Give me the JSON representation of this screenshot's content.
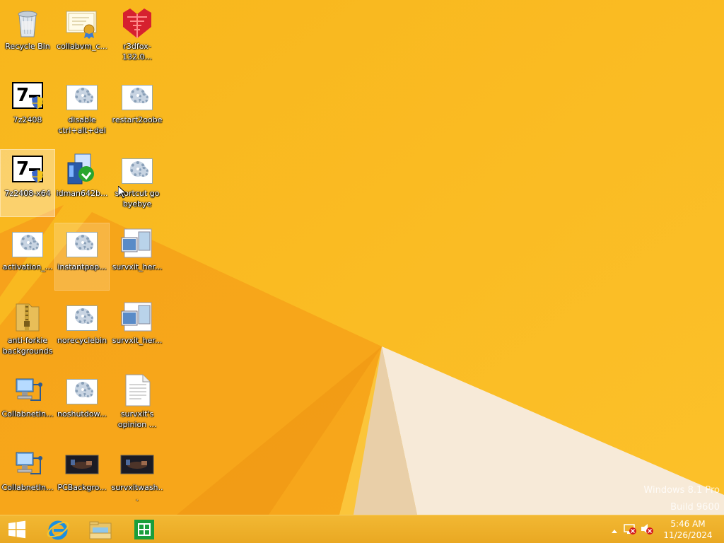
{
  "desktop": {
    "icons": [
      {
        "label": "Recycle Bin",
        "icon": "recycle-bin-icon"
      },
      {
        "label": "collabvm_c...",
        "icon": "certificate-icon"
      },
      {
        "label": "r3dfox-132.0...",
        "icon": "r3dfox-icon"
      },
      {
        "label": "7z2408",
        "icon": "7zip-installer-icon"
      },
      {
        "label": "disable ctrl+alt+del",
        "icon": "settings-file-icon"
      },
      {
        "label": "restart2oobe",
        "icon": "settings-file-icon"
      },
      {
        "label": "7z2408-x64",
        "icon": "7zip-installer-icon"
      },
      {
        "label": "idman642b...",
        "icon": "installer-icon"
      },
      {
        "label": "shortcut go byebye",
        "icon": "settings-file-icon"
      },
      {
        "label": "activation_...",
        "icon": "settings-file-icon"
      },
      {
        "label": "instantpop...",
        "icon": "settings-file-icon"
      },
      {
        "label": "survxit_her...",
        "icon": "image-file-icon"
      },
      {
        "label": "anti-forkie backgrounds",
        "icon": "zip-folder-icon"
      },
      {
        "label": "norecyclebin",
        "icon": "settings-file-icon"
      },
      {
        "label": "survxit_her...",
        "icon": "image-file-icon"
      },
      {
        "label": "CollabnetIn...",
        "icon": "network-computer-icon"
      },
      {
        "label": "noshutdow...",
        "icon": "settings-file-icon"
      },
      {
        "label": "survxit's opinion ...",
        "icon": "text-document-icon"
      },
      {
        "label": "CollabnetIn...",
        "icon": "network-computer-icon"
      },
      {
        "label": "PCBackgro...",
        "icon": "image-thumbnail-icon"
      },
      {
        "label": "survxitwash...",
        "icon": "image-thumbnail-icon"
      }
    ]
  },
  "watermark": {
    "line1": "Windows 8.1 Pro",
    "line2": "Build 9600"
  },
  "taskbar": {
    "start": "start-icon",
    "pinned": [
      "internet-explorer-icon",
      "file-explorer-icon",
      "store-icon"
    ],
    "tray": {
      "time": "5:46 AM",
      "date": "11/26/2024"
    }
  },
  "colors": {
    "wallpaper": "#f7b21a",
    "wallpaper_dark": "#f29c12",
    "taskbar": "#eeaf2a"
  }
}
